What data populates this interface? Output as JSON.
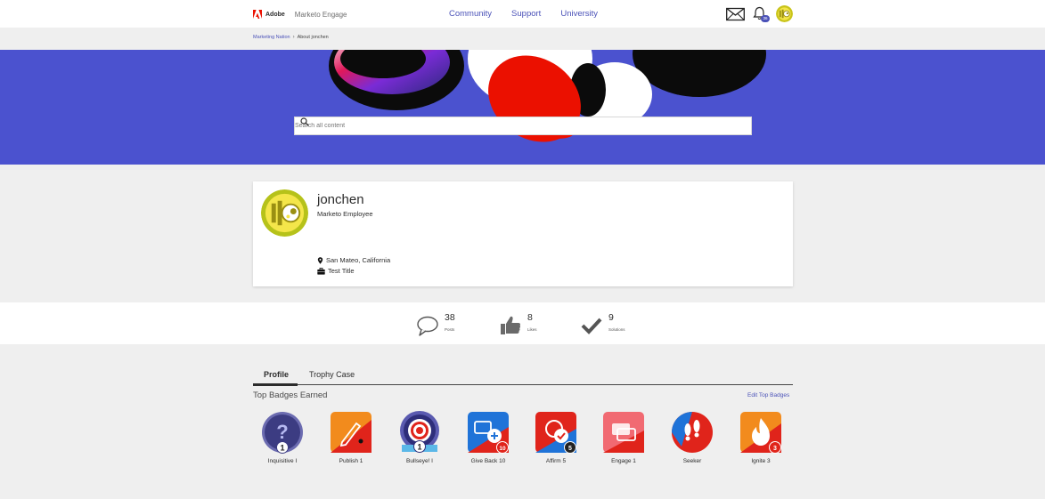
{
  "brand": {
    "company": "Adobe",
    "product": "Marketo Engage"
  },
  "nav": {
    "links": [
      "Community",
      "Support",
      "University"
    ]
  },
  "notifications": {
    "count": "36"
  },
  "breadcrumb": {
    "parent": "Marketing Nation",
    "separator": "›",
    "current": "About jonchen"
  },
  "search": {
    "placeholder": "Search all content"
  },
  "profile": {
    "username": "jonchen",
    "role": "Marketo Employee",
    "location": "San Mateo, California",
    "title": "Test Title"
  },
  "stats": [
    {
      "value": "38",
      "label": "Posts",
      "icon": "comment-icon"
    },
    {
      "value": "8",
      "label": "Likes",
      "icon": "thumbs-up-icon"
    },
    {
      "value": "9",
      "label": "Solutions",
      "icon": "checkmark-icon"
    }
  ],
  "tabs": {
    "profile": "Profile",
    "trophy": "Trophy Case"
  },
  "badges_section": {
    "title": "Top Badges Earned",
    "edit_link": "Edit Top Badges"
  },
  "badges": [
    {
      "label": "Inquisitive I",
      "count": "1",
      "icon": "question-badge-icon"
    },
    {
      "label": "Publish 1",
      "count": "",
      "icon": "pen-badge-icon"
    },
    {
      "label": "Bullseye! I",
      "count": "1",
      "icon": "target-badge-icon"
    },
    {
      "label": "Give Back 10",
      "count": "10",
      "icon": "chat-plus-badge-icon"
    },
    {
      "label": "Affirm 5",
      "count": "5",
      "icon": "check-badge-icon"
    },
    {
      "label": "Engage 1",
      "count": "",
      "icon": "chat-bubbles-badge-icon"
    },
    {
      "label": "Seeker",
      "count": "",
      "icon": "footprints-badge-icon"
    },
    {
      "label": "Ignite 3",
      "count": "3",
      "icon": "flame-badge-icon"
    }
  ],
  "colors": {
    "accent": "#4b52b8",
    "hero": "#4b52cf",
    "adobe_red": "#eb1000"
  }
}
